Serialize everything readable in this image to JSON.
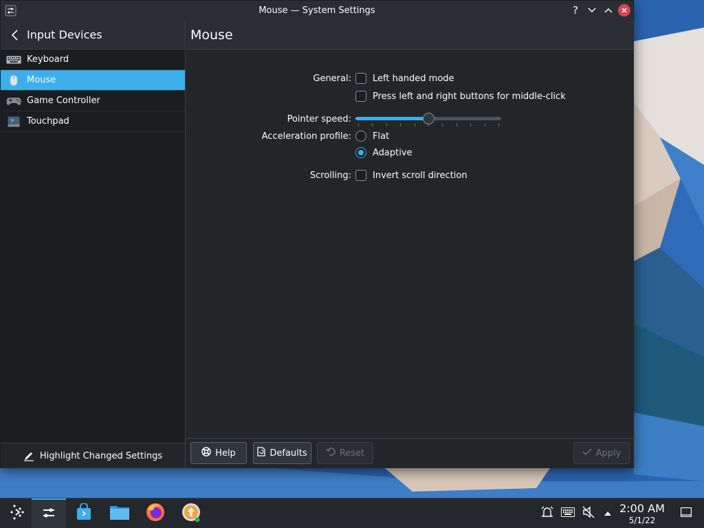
{
  "window": {
    "title": "Mouse — System Settings",
    "controls": {
      "help": "?",
      "minimize": "∨",
      "maximize": "∧",
      "close": "✕"
    }
  },
  "sidebar": {
    "header": "Input Devices",
    "items": [
      {
        "label": "Keyboard",
        "icon": "keyboard-icon",
        "active": false
      },
      {
        "label": "Mouse",
        "icon": "mouse-icon",
        "active": true
      },
      {
        "label": "Game Controller",
        "icon": "game-controller-icon",
        "active": false
      },
      {
        "label": "Touchpad",
        "icon": "touchpad-icon",
        "active": false
      }
    ],
    "footer": "Highlight Changed Settings"
  },
  "main": {
    "title": "Mouse",
    "general_label": "General:",
    "left_handed": "Left handed mode",
    "middle_click": "Press left and right buttons for middle-click",
    "pointer_speed_label": "Pointer speed:",
    "pointer_speed_fraction": 0.5,
    "acceleration_label": "Acceleration profile:",
    "accel_flat": "Flat",
    "accel_adaptive": "Adaptive",
    "accel_selected": "Adaptive",
    "scrolling_label": "Scrolling:",
    "invert_scroll": "Invert scroll direction"
  },
  "buttons": {
    "help": "Help",
    "defaults": "Defaults",
    "reset": "Reset",
    "apply": "Apply"
  },
  "taskbar": {
    "time": "2:00 AM",
    "date": "5/1/22"
  },
  "colors": {
    "accent": "#3daee9",
    "window_bg": "#232629",
    "close": "#da4453"
  }
}
